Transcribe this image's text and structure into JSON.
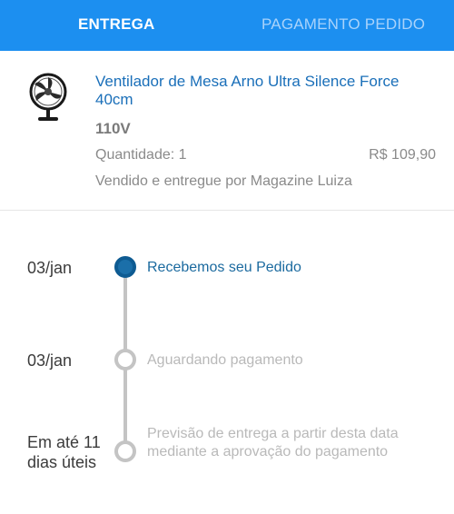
{
  "tabs": {
    "delivery": "ENTREGA",
    "payment": "PAGAMENTO PEDIDO"
  },
  "product": {
    "title": "Ventilador de Mesa Arno Ultra Silence Force 40cm",
    "voltage": "110V",
    "quantity": "Quantidade: 1",
    "price": "R$ 109,90",
    "seller": "Vendido e entregue por Magazine Luiza",
    "image_icon": "table-fan-icon"
  },
  "timeline": {
    "steps": [
      {
        "date": "03/jan",
        "text": "Recebemos seu Pedido",
        "status": "done"
      },
      {
        "date": "03/jan",
        "text": "Aguardando pagamento",
        "status": "pending"
      },
      {
        "date": "Em até 11 dias úteis",
        "text": "Previsão de entrega a partir desta data mediante a aprovação do pagamento",
        "status": "pending"
      }
    ]
  },
  "colors": {
    "header": "#1c8ff0",
    "active_step": "#1b6fa9",
    "inactive": "#c4c4c4",
    "link": "#1a6fb9"
  }
}
